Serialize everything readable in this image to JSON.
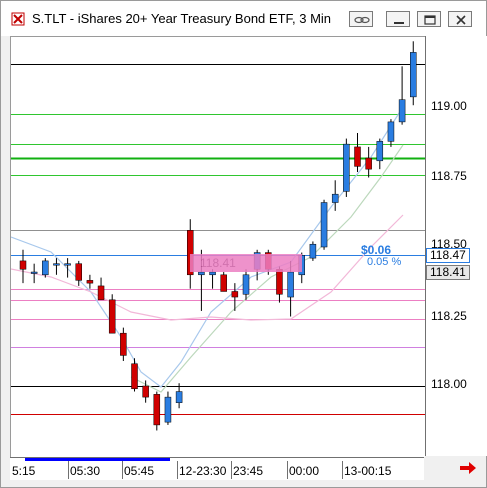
{
  "window": {
    "title": "S.TLT - iShares 20+ Year Treasury Bond ETF, 3 Min"
  },
  "titlebar_buttons": [
    "link",
    "minimize",
    "maximize",
    "close"
  ],
  "y_axis": {
    "labels": [
      "119.00",
      "118.75",
      "118.50",
      "118.25",
      "118.00"
    ],
    "price_tag": "118.47",
    "last_tag": "118.41"
  },
  "x_axis": {
    "labels": [
      "5:15",
      "05:30",
      "05:45",
      "12-23:30",
      "23:45",
      "00:00",
      "13-00:15"
    ]
  },
  "annotations": {
    "change": "$0.06",
    "change_pct": "0.05 %",
    "entry_price": "118.41"
  },
  "colors": {
    "up": "#2a7de1",
    "down": "#d00000",
    "pink": "#ec7fc3",
    "green": "#2fc62f"
  },
  "chart_data": {
    "type": "candlestick",
    "symbol": "S.TLT",
    "interval": "3 Min",
    "ylim": [
      117.86,
      119.28
    ],
    "candles": [
      {
        "o": 118.45,
        "h": 118.49,
        "l": 118.37,
        "c": 118.42
      },
      {
        "o": 118.41,
        "h": 118.44,
        "l": 118.37,
        "c": 118.41
      },
      {
        "o": 118.4,
        "h": 118.46,
        "l": 118.39,
        "c": 118.45
      },
      {
        "o": 118.44,
        "h": 118.46,
        "l": 118.4,
        "c": 118.44
      },
      {
        "o": 118.44,
        "h": 118.46,
        "l": 118.39,
        "c": 118.44
      },
      {
        "o": 118.44,
        "h": 118.45,
        "l": 118.36,
        "c": 118.38
      },
      {
        "o": 118.38,
        "h": 118.4,
        "l": 118.35,
        "c": 118.37
      },
      {
        "o": 118.36,
        "h": 118.39,
        "l": 118.31,
        "c": 118.31
      },
      {
        "o": 118.31,
        "h": 118.33,
        "l": 118.19,
        "c": 118.19
      },
      {
        "o": 118.19,
        "h": 118.21,
        "l": 118.09,
        "c": 118.11
      },
      {
        "o": 118.08,
        "h": 118.1,
        "l": 117.98,
        "c": 117.99
      },
      {
        "o": 118.0,
        "h": 118.02,
        "l": 117.94,
        "c": 117.96
      },
      {
        "o": 117.97,
        "h": 117.98,
        "l": 117.84,
        "c": 117.86
      },
      {
        "o": 117.87,
        "h": 117.98,
        "l": 117.86,
        "c": 117.96
      },
      {
        "o": 117.94,
        "h": 118.01,
        "l": 117.92,
        "c": 117.98
      },
      {
        "o": 118.56,
        "h": 118.6,
        "l": 118.35,
        "c": 118.4
      },
      {
        "o": 118.4,
        "h": 118.49,
        "l": 118.27,
        "c": 118.41
      },
      {
        "o": 118.4,
        "h": 118.42,
        "l": 118.35,
        "c": 118.41
      },
      {
        "o": 118.4,
        "h": 118.41,
        "l": 118.34,
        "c": 118.34
      },
      {
        "o": 118.34,
        "h": 118.37,
        "l": 118.27,
        "c": 118.32
      },
      {
        "o": 118.33,
        "h": 118.42,
        "l": 118.31,
        "c": 118.4
      },
      {
        "o": 118.42,
        "h": 118.49,
        "l": 118.38,
        "c": 118.48
      },
      {
        "o": 118.48,
        "h": 118.49,
        "l": 118.4,
        "c": 118.42
      },
      {
        "o": 118.42,
        "h": 118.43,
        "l": 118.3,
        "c": 118.33
      },
      {
        "o": 118.32,
        "h": 118.45,
        "l": 118.25,
        "c": 118.41
      },
      {
        "o": 118.4,
        "h": 118.48,
        "l": 118.37,
        "c": 118.47
      },
      {
        "o": 118.46,
        "h": 118.52,
        "l": 118.45,
        "c": 118.51
      },
      {
        "o": 118.5,
        "h": 118.67,
        "l": 118.49,
        "c": 118.66
      },
      {
        "o": 118.66,
        "h": 118.74,
        "l": 118.63,
        "c": 118.69
      },
      {
        "o": 118.7,
        "h": 118.89,
        "l": 118.68,
        "c": 118.87
      },
      {
        "o": 118.86,
        "h": 118.91,
        "l": 118.77,
        "c": 118.79
      },
      {
        "o": 118.82,
        "h": 118.86,
        "l": 118.75,
        "c": 118.78
      },
      {
        "o": 118.81,
        "h": 118.89,
        "l": 118.78,
        "c": 118.88
      },
      {
        "o": 118.88,
        "h": 118.96,
        "l": 118.86,
        "c": 118.95
      },
      {
        "o": 118.95,
        "h": 119.15,
        "l": 118.94,
        "c": 119.03
      },
      {
        "o": 119.04,
        "h": 119.24,
        "l": 119.01,
        "c": 119.2
      }
    ],
    "horizontal_levels": [
      {
        "price": 119.28,
        "color": "#d00000"
      },
      {
        "price": 119.16,
        "color": "#000000"
      },
      {
        "price": 118.98,
        "color": "#2fc62f"
      },
      {
        "price": 118.87,
        "color": "#2fc62f"
      },
      {
        "price": 118.82,
        "color": "#10b010"
      },
      {
        "price": 118.76,
        "color": "#2fc62f"
      },
      {
        "price": 118.56,
        "color": "#909090"
      },
      {
        "price": 118.47,
        "color": "#2a7de1"
      },
      {
        "price": 118.35,
        "color": "#ec7fc3"
      },
      {
        "price": 118.31,
        "color": "#ec7fc3"
      },
      {
        "price": 118.24,
        "color": "#ec7fc3"
      },
      {
        "price": 118.14,
        "color": "#d080e0"
      },
      {
        "price": 118.0,
        "color": "#000000"
      },
      {
        "price": 117.9,
        "color": "#d00000"
      }
    ]
  }
}
